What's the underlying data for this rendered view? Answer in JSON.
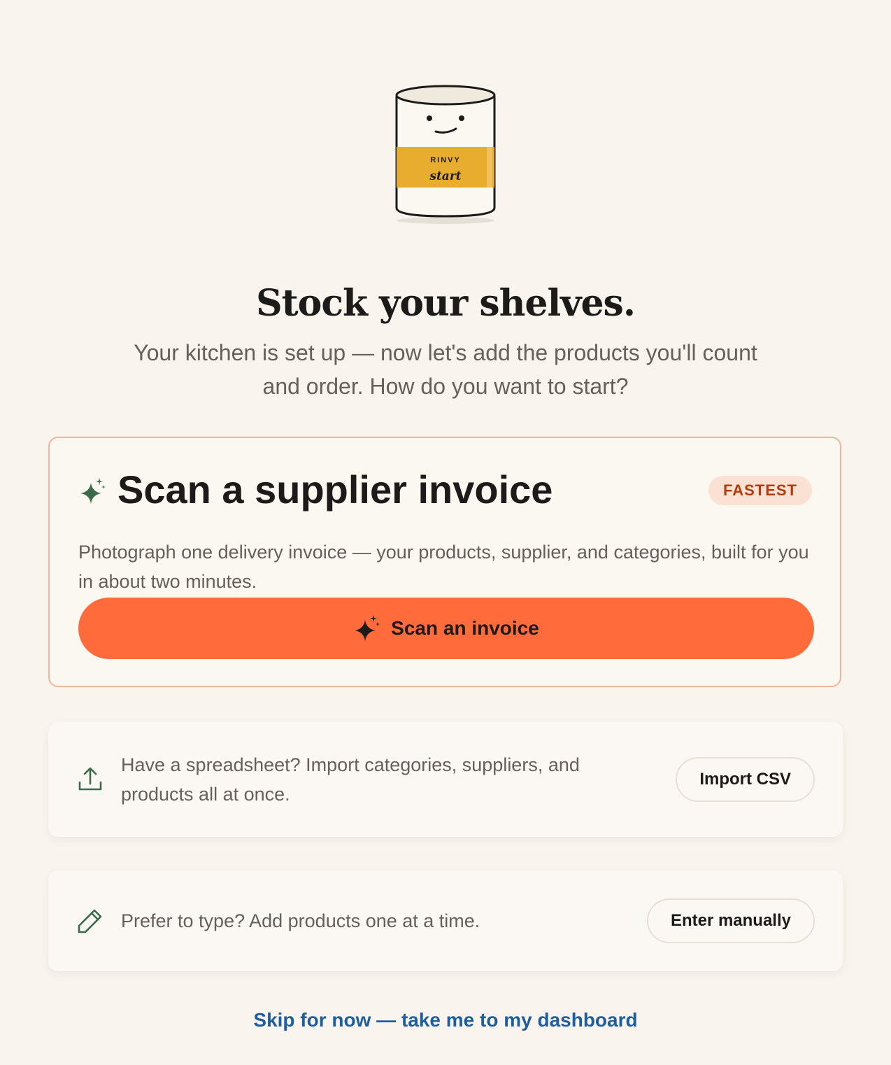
{
  "mascot": {
    "brand": "RINVY",
    "label": "start"
  },
  "header": {
    "title": "Stock your shelves.",
    "subtitle": "Your kitchen is set up — now let's add the products you'll count and order. How do you want to start?"
  },
  "primary_option": {
    "title": "Scan a supplier invoice",
    "badge": "FASTEST",
    "description": "Photograph one delivery invoice — your products, supplier, and categories, built for you in about two minutes.",
    "button_label": "Scan an invoice",
    "icon": "sparkle-icon"
  },
  "csv_option": {
    "text": "Have a spreadsheet? Import categories, suppliers, and products all at once.",
    "button_label": "Import CSV",
    "icon": "upload-icon"
  },
  "manual_option": {
    "text": "Prefer to type? Add products one at a time.",
    "button_label": "Enter manually",
    "icon": "pencil-icon"
  },
  "skip_link": "Skip for now — take me to my dashboard",
  "colors": {
    "background": "#f9f5ee",
    "accent": "#ff6b3a",
    "badge_bg": "#fbe1d4",
    "badge_text": "#b23c0b",
    "icon_green": "#3d6b4a",
    "link": "#1f5e9e",
    "label_band": "#e8ad2e"
  }
}
